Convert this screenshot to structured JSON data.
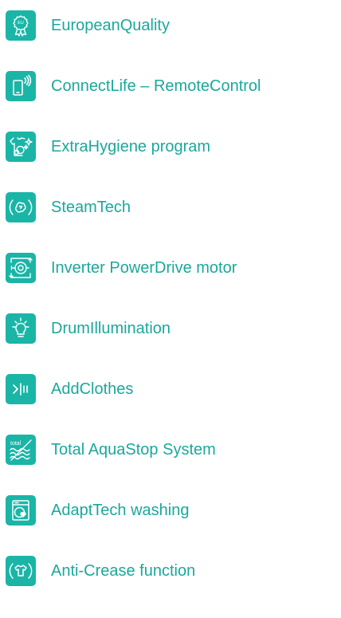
{
  "features": [
    {
      "label": "EuropeanQuality",
      "icon": "eu-quality-badge-icon"
    },
    {
      "label": "ConnectLife – RemoteControl",
      "icon": "smartphone-signal-icon"
    },
    {
      "label": "ExtraHygiene program",
      "icon": "hygiene-shirt-icon"
    },
    {
      "label": "SteamTech",
      "icon": "steam-icon"
    },
    {
      "label": "Inverter PowerDrive motor",
      "icon": "inverter-motor-icon"
    },
    {
      "label": "DrumIllumination",
      "icon": "light-bulb-icon"
    },
    {
      "label": "AddClothes",
      "icon": "add-clothes-icon"
    },
    {
      "label": "Total AquaStop System",
      "icon": "aquastop-icon",
      "icon_text": "total"
    },
    {
      "label": "AdaptTech washing",
      "icon": "washing-machine-heart-icon"
    },
    {
      "label": "Anti-Crease function",
      "icon": "anti-crease-shirt-icon"
    }
  ],
  "colors": {
    "accent": "#1ab5a7",
    "text": "#1ba89b",
    "icon_stroke": "#ffffff"
  }
}
